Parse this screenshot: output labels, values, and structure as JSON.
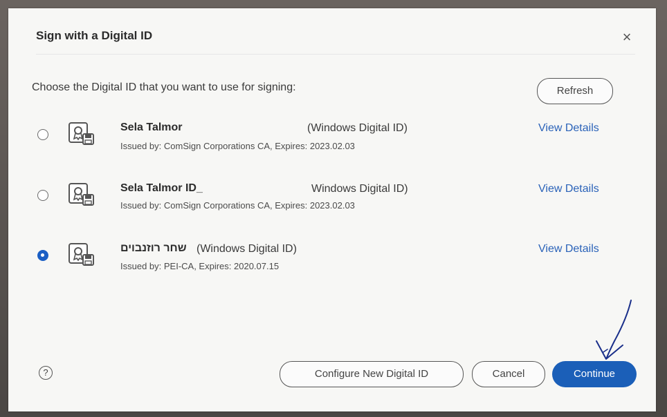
{
  "dialog": {
    "title": "Sign with a Digital ID",
    "close_icon": "×",
    "prompt": "Choose the Digital ID that you want to use for signing:",
    "refresh_label": "Refresh"
  },
  "ids": [
    {
      "name": "Sela Talmor",
      "type": "(Windows Digital ID)",
      "issued": "Issued by: ComSign Corporations CA, Expires: 2023.02.03",
      "details_label": "View Details",
      "selected": false
    },
    {
      "name": "Sela Talmor ID_",
      "type": "Windows Digital ID)",
      "issued": "Issued by: ComSign Corporations CA, Expires: 2023.02.03",
      "details_label": "View Details",
      "selected": false
    },
    {
      "name": "שחר רוזנבוים",
      "type": "(Windows Digital ID)",
      "issued": "Issued by: PEI-CA, Expires: 2020.07.15",
      "details_label": "View Details",
      "selected": true
    }
  ],
  "footer": {
    "help_icon": "?",
    "configure_label": "Configure New Digital ID",
    "cancel_label": "Cancel",
    "continue_label": "Continue"
  },
  "colors": {
    "accent": "#1b5fb8",
    "link": "#2a62b8"
  },
  "icons": [
    "close-icon",
    "certificate-icon",
    "help-icon",
    "hand-drawn-arrow"
  ]
}
